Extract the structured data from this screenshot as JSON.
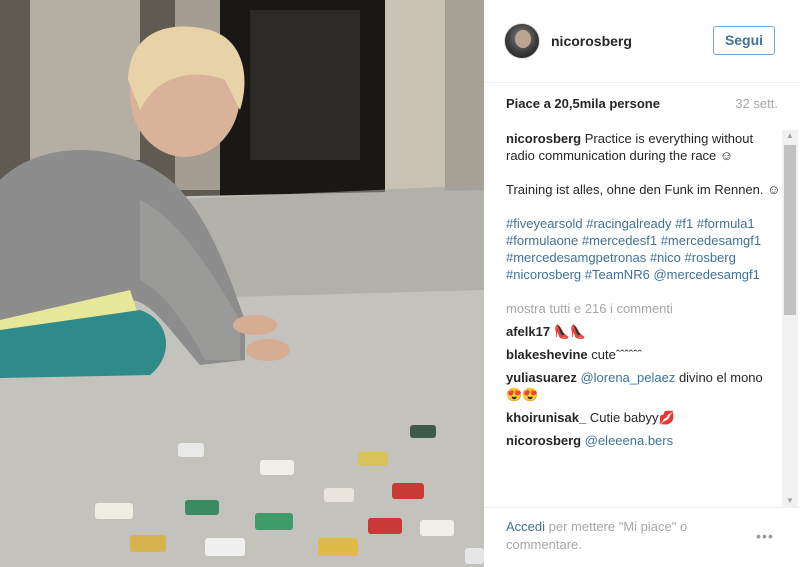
{
  "photo": {
    "description_icon": "photo-image"
  },
  "header": {
    "username": "nicorosberg",
    "follow_label": "Segui"
  },
  "stats": {
    "likes": "Piace a 20,5mila persone",
    "age": "32 sett."
  },
  "caption": {
    "username": "nicorosberg",
    "text_en": "Practice is everything without radio communication during the race ☺",
    "text_de": "Training ist alles, ohne den Funk im Rennen. ☺",
    "tags": [
      "#fiveyearsold",
      "#racingalready",
      "#f1",
      "#formula1",
      "#formulaone",
      "#mercedesf1",
      "#mercedesamgf1",
      "#mercedesamgpetronas",
      "#nico",
      "#rosberg",
      "#nicorosberg",
      "#TeamNR6",
      "@mercedesamgf1"
    ]
  },
  "show_all": "mostra tutti e 216 i commenti",
  "comments": [
    {
      "user": "afelk17",
      "text": "👠👠"
    },
    {
      "user": "blakeshevine",
      "text": "cuteˆˆˆˆˆˆ"
    },
    {
      "user": "yuliasuarez",
      "mention": "@lorena_pelaez",
      "text": " divino el mono 😍😍"
    },
    {
      "user": "khoirunisak_",
      "text": "Cutie babyy💋"
    },
    {
      "user": "nicorosberg",
      "mention": "@eleeena.bers",
      "text": ""
    }
  ],
  "footer": {
    "link": "Accedi",
    "text": " per mettere \"Mi piace\" o commentare.",
    "more": "•••"
  },
  "colors": {
    "link_blue": "#3f729b",
    "follow_border": "#6fa6d6",
    "muted_gray": "#a5a7aa"
  }
}
